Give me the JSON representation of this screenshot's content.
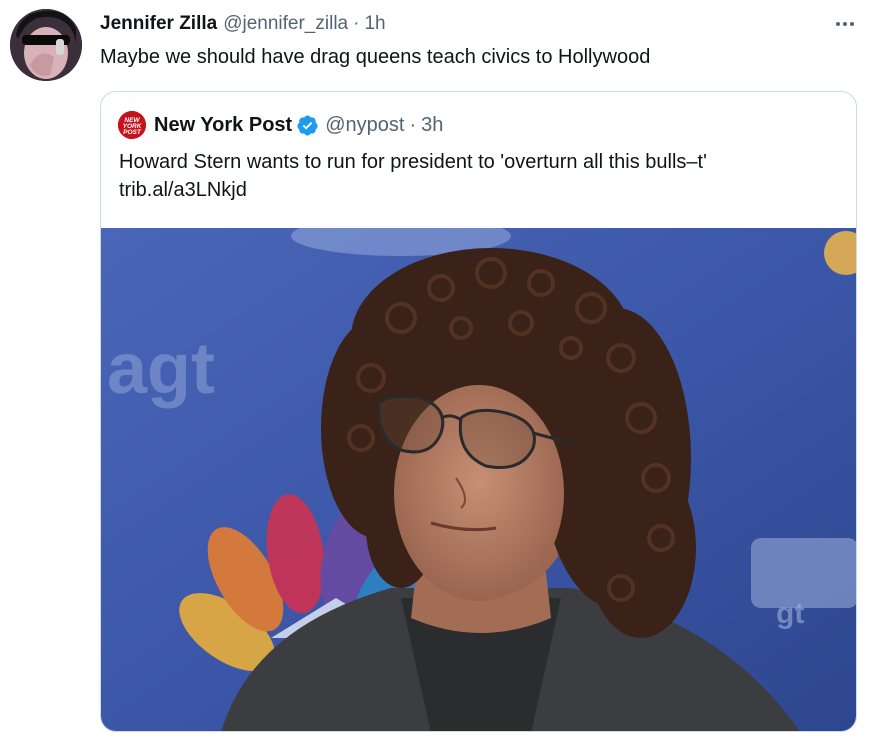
{
  "tweet": {
    "author_name": "Jennifer Zilla",
    "author_handle": "@jennifer_zilla",
    "separator": "·",
    "time": "1h",
    "text": "Maybe we should have drag queens teach civics to Hollywood",
    "more_icon": "more-horizontal-icon"
  },
  "quoted_tweet": {
    "author_name": "New York Post",
    "logo_text": [
      "NEW",
      "YORK",
      "POST"
    ],
    "author_handle": "@nypost",
    "separator": "·",
    "time": "3h",
    "text": "Howard Stern wants to run for president to 'overturn all this bulls–t'",
    "link": "trib.al/a3LNkjd",
    "verified_icon": "verified-badge-icon",
    "photo_backdrop_text": [
      "agt",
      "gt"
    ]
  },
  "colors": {
    "text_primary": "#0f1419",
    "text_secondary": "#536471",
    "verified_blue": "#1d9bf0",
    "border": "#cfd9de",
    "nypost_red": "#c5121b"
  }
}
